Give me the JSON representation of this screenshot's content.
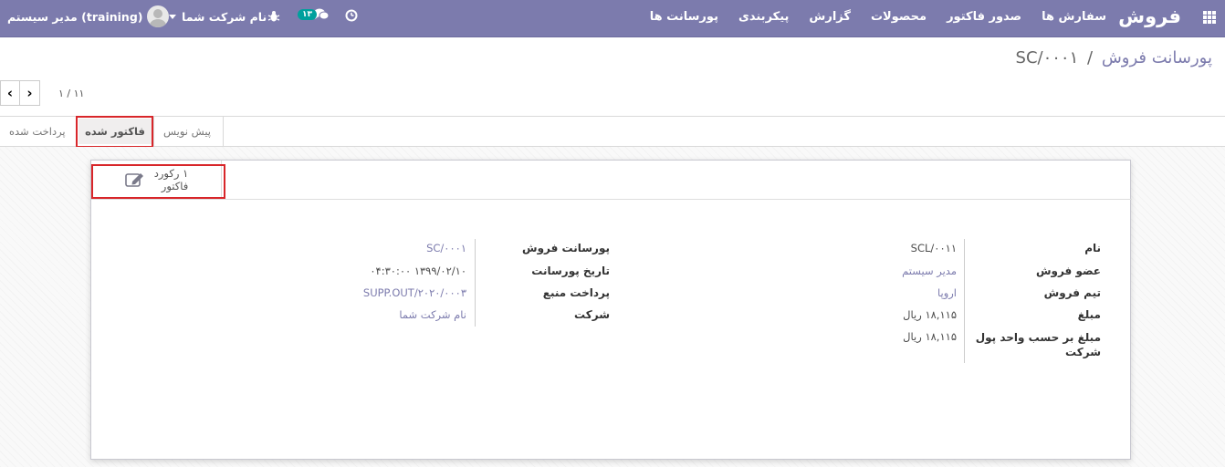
{
  "navbar": {
    "brand": "فروش",
    "menu": [
      "سفارش ها",
      "صدور فاکتور",
      "محصولات",
      "گزارش",
      "پیکربندی",
      "پورسانت ها"
    ],
    "user_name": "مدیر سیستم (training)",
    "company": "نام شرکت شما",
    "chat_count": "۱۳"
  },
  "breadcrumb": {
    "parent": "پورسانت فروش",
    "separator": "/",
    "current": "SC/۰۰۰۱"
  },
  "pager": {
    "value": "۱ / ۱۱",
    "prev": "‹",
    "next": "›"
  },
  "statusbar": {
    "stages": [
      "پیش نویس",
      "فاکتور شده",
      "پرداخت شده"
    ],
    "active": "فاکتور شده"
  },
  "stat_button": {
    "count_label": "۱ رکورد",
    "name": "فاکتور"
  },
  "right_group": {
    "name_label": "نام",
    "name_value": "SCL/۰۰۱۱",
    "member_label": "عضو فروش",
    "member_value": "مدیر سیستم",
    "team_label": "تیم فروش",
    "team_value": "اروپا",
    "amount_label": "مبلغ",
    "amount_value": "۱۸,۱۱۵ ریال",
    "amount_company_label_1": "مبلغ بر حسب واحد پول",
    "amount_company_label_2": "شرکت",
    "amount_company_value": "۱۸,۱۱۵ ریال"
  },
  "left_group": {
    "commission_label": "پورسانت فروش",
    "commission_value": "SC/۰۰۰۱",
    "date_label": "تاریخ پورسانت",
    "date_value": "۱۳۹۹/۰۲/۱۰ ۰۴:۳۰:۰۰",
    "payment_label": "پرداخت منبع",
    "payment_value": "SUPP.OUT/۲۰۲۰/۰۰۰۳",
    "company_label": "شرکت",
    "company_value": "نام شرکت شما"
  },
  "colors": {
    "navbar": "#7c7bad",
    "link": "#7c7bad",
    "highlight": "#d8262a",
    "chat_badge": "#00a09d"
  }
}
